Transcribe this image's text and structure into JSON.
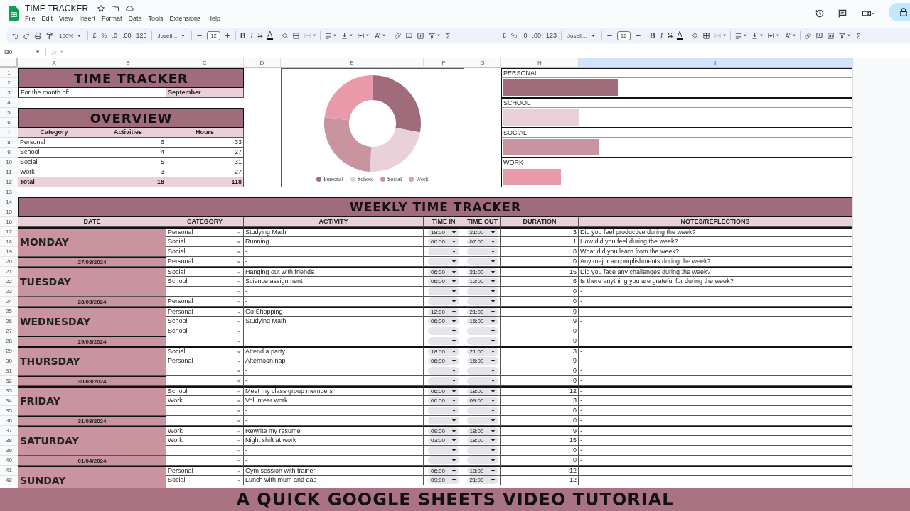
{
  "document": {
    "title": "TIME TRACKER"
  },
  "menu": [
    "File",
    "Edit",
    "View",
    "Insert",
    "Format",
    "Data",
    "Tools",
    "Extensions",
    "Help"
  ],
  "toolbar": [
    {
      "items": [
        {
          "kind": "undo"
        },
        {
          "kind": "redo"
        },
        {
          "kind": "print"
        },
        {
          "kind": "paint"
        },
        {
          "kind": "select",
          "label": "100%"
        },
        {
          "kind": "sep"
        },
        {
          "kind": "text",
          "label": "£"
        },
        {
          "kind": "text",
          "label": "%"
        },
        {
          "kind": "text",
          "label": ".0"
        },
        {
          "kind": "text",
          "label": ".00"
        },
        {
          "kind": "text",
          "label": "123"
        },
        {
          "kind": "sep"
        },
        {
          "kind": "select",
          "label": "Josefi..."
        },
        {
          "kind": "sep"
        },
        {
          "kind": "minus"
        },
        {
          "kind": "size",
          "label": "12"
        },
        {
          "kind": "plus"
        },
        {
          "kind": "sep"
        },
        {
          "kind": "bold",
          "label": "B"
        },
        {
          "kind": "italic",
          "label": "I"
        },
        {
          "kind": "strike",
          "label": "S"
        },
        {
          "kind": "color",
          "label": "A"
        },
        {
          "kind": "sep"
        },
        {
          "kind": "fill"
        },
        {
          "kind": "borders"
        },
        {
          "kind": "merge",
          "menu": true
        },
        {
          "kind": "sep"
        },
        {
          "kind": "align",
          "menu": true
        },
        {
          "kind": "valign",
          "menu": true
        },
        {
          "kind": "wrap",
          "menu": true
        },
        {
          "kind": "rotate",
          "menu": true
        },
        {
          "kind": "sep"
        },
        {
          "kind": "link"
        },
        {
          "kind": "comment"
        },
        {
          "kind": "chart"
        },
        {
          "kind": "filter",
          "menu": true
        },
        {
          "kind": "sigma"
        }
      ]
    },
    {
      "items": [
        {
          "kind": "text",
          "label": "£"
        },
        {
          "kind": "text",
          "label": "%"
        },
        {
          "kind": "text",
          "label": ".0"
        },
        {
          "kind": "text",
          "label": ".00"
        },
        {
          "kind": "text",
          "label": "123"
        },
        {
          "kind": "sep"
        },
        {
          "kind": "select",
          "label": "Josefi..."
        },
        {
          "kind": "sep"
        },
        {
          "kind": "minus"
        },
        {
          "kind": "size",
          "label": "12"
        },
        {
          "kind": "plus"
        },
        {
          "kind": "sep"
        },
        {
          "kind": "bold",
          "label": "B"
        },
        {
          "kind": "italic",
          "label": "I"
        },
        {
          "kind": "strike",
          "label": "S"
        },
        {
          "kind": "color",
          "label": "A"
        },
        {
          "kind": "sep"
        },
        {
          "kind": "fill"
        },
        {
          "kind": "borders"
        },
        {
          "kind": "merge",
          "menu": true
        },
        {
          "kind": "sep"
        },
        {
          "kind": "align",
          "menu": true
        },
        {
          "kind": "valign",
          "menu": true
        },
        {
          "kind": "wrap",
          "menu": true
        },
        {
          "kind": "rotate",
          "menu": true
        },
        {
          "kind": "sep"
        },
        {
          "kind": "link"
        },
        {
          "kind": "comment"
        },
        {
          "kind": "chart"
        },
        {
          "kind": "filter",
          "menu": true
        },
        {
          "kind": "sigma"
        }
      ]
    }
  ],
  "formula_bar": {
    "cell": "I30",
    "fx": "fx"
  },
  "column_headers": [
    {
      "label": "A",
      "selected": false
    },
    {
      "label": "B",
      "selected": false
    },
    {
      "label": "C",
      "selected": false
    },
    {
      "label": "D",
      "selected": false
    },
    {
      "label": "E",
      "selected": false
    },
    {
      "label": "F",
      "selected": false
    },
    {
      "label": "G",
      "selected": false
    },
    {
      "label": "H",
      "selected": false
    },
    {
      "label": "I",
      "selected": true
    }
  ],
  "row_numbers": [
    "1",
    "2",
    "3",
    "4",
    "5",
    "6",
    "7",
    "8",
    "9",
    "10",
    "11",
    "12",
    "13",
    "14",
    "15",
    "16",
    "17",
    "18",
    "19",
    "20",
    "21",
    "22",
    "23",
    "24",
    "25",
    "26",
    "27",
    "28",
    "29",
    "30",
    "31",
    "32",
    "33",
    "34",
    "35",
    "36",
    "37",
    "38",
    "39",
    "40",
    "41",
    "42"
  ],
  "title": "TIME TRACKER",
  "month": {
    "label": "For the month of:",
    "value": "September"
  },
  "overview": {
    "title": "OVERVIEW",
    "columns": [
      "Category",
      "Activities",
      "Hours"
    ],
    "rows": [
      {
        "category": "Personal",
        "activities": "6",
        "hours": "33"
      },
      {
        "category": "School",
        "activities": "4",
        "hours": "27"
      },
      {
        "category": "Social",
        "activities": "5",
        "hours": "31"
      },
      {
        "category": "Work",
        "activities": "3",
        "hours": "27"
      }
    ],
    "total": {
      "label": "Total",
      "activities": "18",
      "hours": "118"
    }
  },
  "chart": {
    "legend": [
      {
        "label": "Personal",
        "color": "#a06b7a"
      },
      {
        "label": "School",
        "color": "#ead1d9"
      },
      {
        "label": "Social",
        "color": "#c9949f"
      },
      {
        "label": "Work",
        "color": "#e99aaa"
      }
    ]
  },
  "bars": [
    {
      "label": "PERSONAL",
      "level": 0.33,
      "color": "#a06b7a"
    },
    {
      "label": "SCHOOL",
      "level": 0.22,
      "color": "#ead1d9"
    },
    {
      "label": "SOCIAL",
      "level": 0.275,
      "color": "#c9949f"
    },
    {
      "label": "WORK",
      "level": 0.165,
      "color": "#e99aaa"
    }
  ],
  "weekly": {
    "title": "WEEKLY TIME TRACKER",
    "columns": [
      "DATE",
      "CATEGORY",
      "ACTIVITY",
      "TIME IN",
      "TIME OUT",
      "DURATION",
      "NOTES/REFLECTIONS"
    ],
    "days": [
      {
        "day": "MONDAY",
        "date": "27/03/2024",
        "entries": [
          {
            "category": "Personal",
            "activity": "Studying Math",
            "time_in": "18:00",
            "time_out": "21:00",
            "duration": "3",
            "note": "Did you feel productive during the week?"
          },
          {
            "category": "Social",
            "activity": "Running",
            "time_in": "06:00",
            "time_out": "07:00",
            "duration": "1",
            "note": "How did you feel during the week?"
          },
          {
            "category": "Social",
            "activity": "-",
            "duration": "0",
            "note": "What did you learn from the week?"
          },
          {
            "category": "Personal",
            "activity": "-",
            "duration": "0",
            "note": "Any major accomplishments during the week?"
          }
        ]
      },
      {
        "day": "TUESDAY",
        "date": "28/03/2024",
        "entries": [
          {
            "category": "Social",
            "activity": "Hanging out with friends",
            "time_in": "06:00",
            "time_out": "21:00",
            "duration": "15",
            "note": "Did you face any challenges during the week?"
          },
          {
            "category": "School",
            "activity": "Science assignment",
            "time_in": "06:00",
            "time_out": "12:00",
            "duration": "6",
            "note": "Is there anything you are grateful for during the week?"
          },
          {
            "activity": "-",
            "duration": "0",
            "note": "-"
          },
          {
            "category": "Personal",
            "activity": "-",
            "duration": "0",
            "note": "-"
          }
        ]
      },
      {
        "day": "WEDNESDAY",
        "date": "29/03/2024",
        "entries": [
          {
            "category": "Personal",
            "activity": "Go Shopping",
            "time_in": "12:00",
            "time_out": "21:00",
            "duration": "9",
            "note": "-"
          },
          {
            "category": "School",
            "activity": "Studying Math",
            "time_in": "06:00",
            "time_out": "15:00",
            "duration": "9",
            "note": "-"
          },
          {
            "category": "School",
            "activity": "-",
            "duration": "0",
            "note": "-"
          },
          {
            "activity": "-",
            "duration": "0",
            "note": "-"
          }
        ]
      },
      {
        "day": "THURSDAY",
        "date": "30/03/2024",
        "entries": [
          {
            "category": "Social",
            "activity": "Attend a party",
            "time_in": "18:00",
            "time_out": "21:00",
            "duration": "3",
            "note": "-"
          },
          {
            "category": "Personal",
            "activity": "Afternoon nap",
            "time_in": "06:00",
            "time_out": "15:00",
            "duration": "9",
            "note": "-"
          },
          {
            "activity": "-",
            "duration": "0",
            "note": "-"
          },
          {
            "activity": "-",
            "duration": "0",
            "note": "-"
          }
        ]
      },
      {
        "day": "FRIDAY",
        "date": "31/03/2024",
        "entries": [
          {
            "category": "School",
            "activity": "Meet my class group members",
            "time_in": "06:00",
            "time_out": "18:00",
            "duration": "12",
            "note": "-"
          },
          {
            "category": "Work",
            "activity": "Volunteer work",
            "time_in": "06:00",
            "time_out": "09:00",
            "duration": "3",
            "note": "-"
          },
          {
            "activity": "-",
            "duration": "0",
            "note": "-"
          },
          {
            "activity": "-",
            "duration": "0",
            "note": "-"
          }
        ]
      },
      {
        "day": "SATURDAY",
        "date": "01/04/2024",
        "entries": [
          {
            "category": "Work",
            "activity": "Rewrite my resume",
            "time_in": "09:00",
            "time_out": "18:00",
            "duration": "9",
            "note": "-"
          },
          {
            "category": "Work",
            "activity": "Night shift at work",
            "time_in": "03:00",
            "time_out": "18:00",
            "duration": "15",
            "note": "-"
          },
          {
            "activity": "-",
            "duration": "0",
            "note": "-"
          },
          {
            "activity": "-",
            "duration": "0",
            "note": "-"
          }
        ]
      },
      {
        "day": "SUNDAY",
        "entries": [
          {
            "category": "Personal",
            "activity": "Gym session with trainer",
            "time_in": "06:00",
            "time_out": "18:00",
            "duration": "12",
            "note": "-"
          },
          {
            "category": "Social",
            "activity": "Lunch with mum and dad",
            "time_in": "09:00",
            "time_out": "21:00",
            "duration": "12",
            "note": "-"
          }
        ]
      }
    ]
  },
  "banner": "A QUICK GOOGLE SHEETS VIDEO TUTORIAL"
}
